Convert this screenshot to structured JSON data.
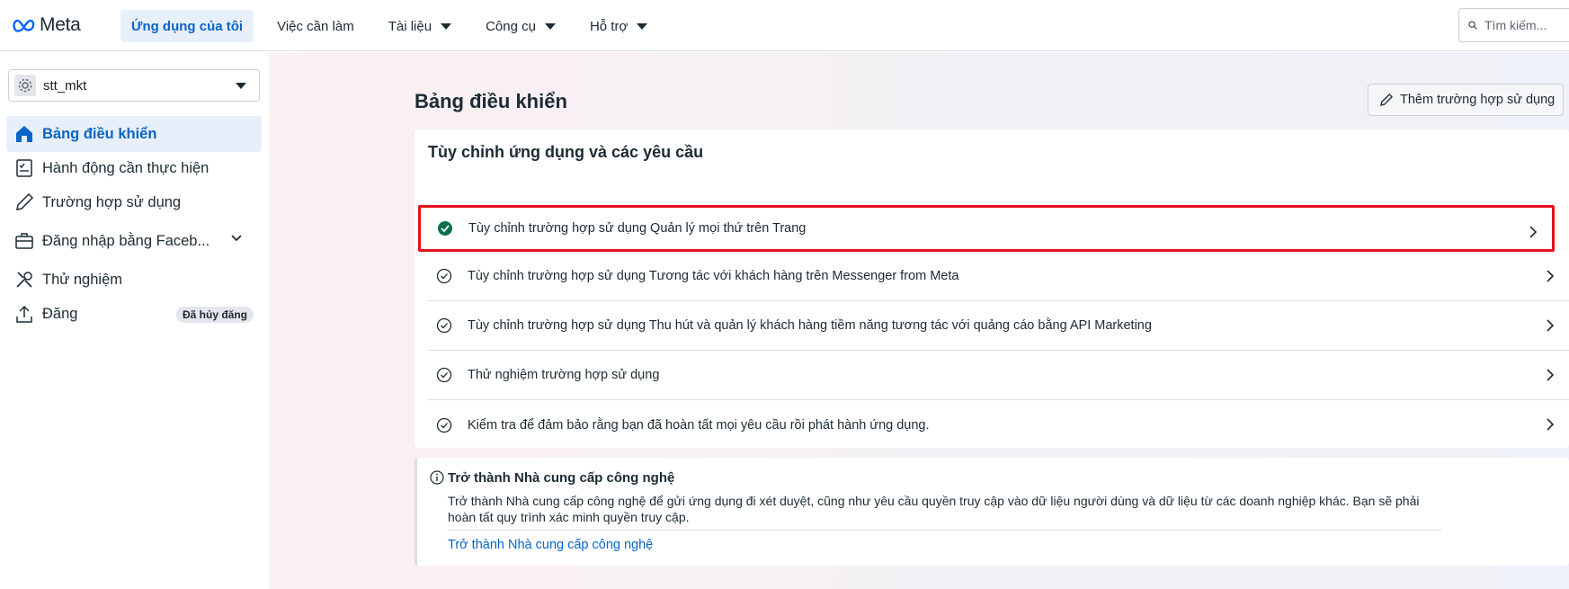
{
  "header": {
    "logo_text": "Meta",
    "nav": [
      {
        "label": "Ứng dụng của tôi",
        "active": true
      },
      {
        "label": "Việc cần làm"
      },
      {
        "label": "Tài liệu",
        "dropdown": true
      },
      {
        "label": "Công cụ",
        "dropdown": true
      },
      {
        "label": "Hỗ trợ",
        "dropdown": true
      }
    ],
    "search_placeholder": "Tìm kiếm..."
  },
  "sidebar": {
    "app_name": "stt_mkt",
    "items": [
      {
        "label": "Bảng điều khiển",
        "icon": "home-icon",
        "active": true
      },
      {
        "label": "Hành động cần thực hiện",
        "icon": "checklist-icon"
      },
      {
        "label": "Trường hợp sử dụng",
        "icon": "pencil-icon"
      },
      {
        "label": "Đăng nhập bằng Faceb...",
        "icon": "briefcase-icon"
      },
      {
        "label": "Thử nghiệm",
        "icon": "tools-icon"
      },
      {
        "label": "Đăng",
        "icon": "upload-icon",
        "badge": "Đã hủy đăng"
      }
    ]
  },
  "main": {
    "title": "Bảng điều khiển",
    "add_use_case": "Thêm trường hợp sử dụng",
    "card_title": "Tùy chỉnh ứng dụng và các yêu cầu",
    "rows": [
      {
        "text": "Tùy chỉnh trường hợp sử dụng Quản lý mọi thứ trên Trang",
        "status": "complete"
      },
      {
        "text": "Tùy chỉnh trường hợp sử dụng Tương tác với khách hàng trên Messenger from Meta",
        "status": "pending"
      },
      {
        "text": "Tùy chỉnh trường hợp sử dụng Thu hút và quản lý khách hàng tiềm năng tương tác với quảng cáo bằng API Marketing",
        "status": "pending"
      },
      {
        "text": "Thử nghiệm trường hợp sử dụng",
        "status": "pending"
      },
      {
        "text": "Kiểm tra để đảm bảo rằng bạn đã hoàn tất mọi yêu cầu rồi phát hành ứng dụng.",
        "status": "pending"
      }
    ],
    "tech_provider": {
      "title": "Trở thành Nhà cung cấp công nghệ",
      "description": "Trở thành Nhà cung cấp công nghệ để gửi ứng dụng đi xét duyệt, cũng như yêu cầu quyền truy cập vào dữ liệu người dùng và dữ liệu từ các doanh nghiệp khác. Bạn sẽ phải hoàn tất quy trình xác minh quyền truy cập.",
      "link": "Trở thành Nhà cung cấp công nghệ"
    }
  },
  "colors": {
    "accent": "#0a64c7",
    "complete": "#0b6e4f",
    "highlight": "#e4121f"
  }
}
